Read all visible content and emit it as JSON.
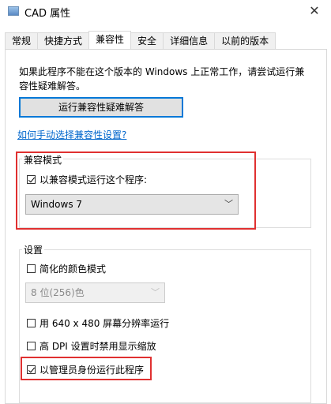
{
  "window": {
    "title": "CAD 属性",
    "close_glyph": "✕"
  },
  "tabs": [
    {
      "label": "常规",
      "active": false
    },
    {
      "label": "快捷方式",
      "active": false
    },
    {
      "label": "兼容性",
      "active": true
    },
    {
      "label": "安全",
      "active": false
    },
    {
      "label": "详细信息",
      "active": false
    },
    {
      "label": "以前的版本",
      "active": false
    }
  ],
  "compat": {
    "description": "如果此程序不能在这个版本的 Windows 上正常工作，请尝试运行兼容性疑难解答。",
    "troubleshoot_button": "运行兼容性疑难解答",
    "manual_link": "如何手动选择兼容性设置?"
  },
  "compat_mode": {
    "group_label": "兼容模式",
    "run_in_compat_label": "以兼容模式运行这个程序:",
    "run_in_compat_checked": true,
    "os_selected": "Windows 7"
  },
  "settings": {
    "group_label": "设置",
    "reduced_color_label": "简化的颜色模式",
    "reduced_color_checked": false,
    "color_selected": "8 位(256)色",
    "res_640_label": "用 640 x 480 屏幕分辨率运行",
    "res_640_checked": false,
    "high_dpi_label": "高 DPI 设置时禁用显示缩放",
    "high_dpi_checked": false,
    "admin_label": "以管理员身份运行此程序",
    "admin_checked": true
  },
  "colors": {
    "accent": "#0078d7",
    "highlight_box": "#e03030",
    "link": "#0066cc"
  }
}
